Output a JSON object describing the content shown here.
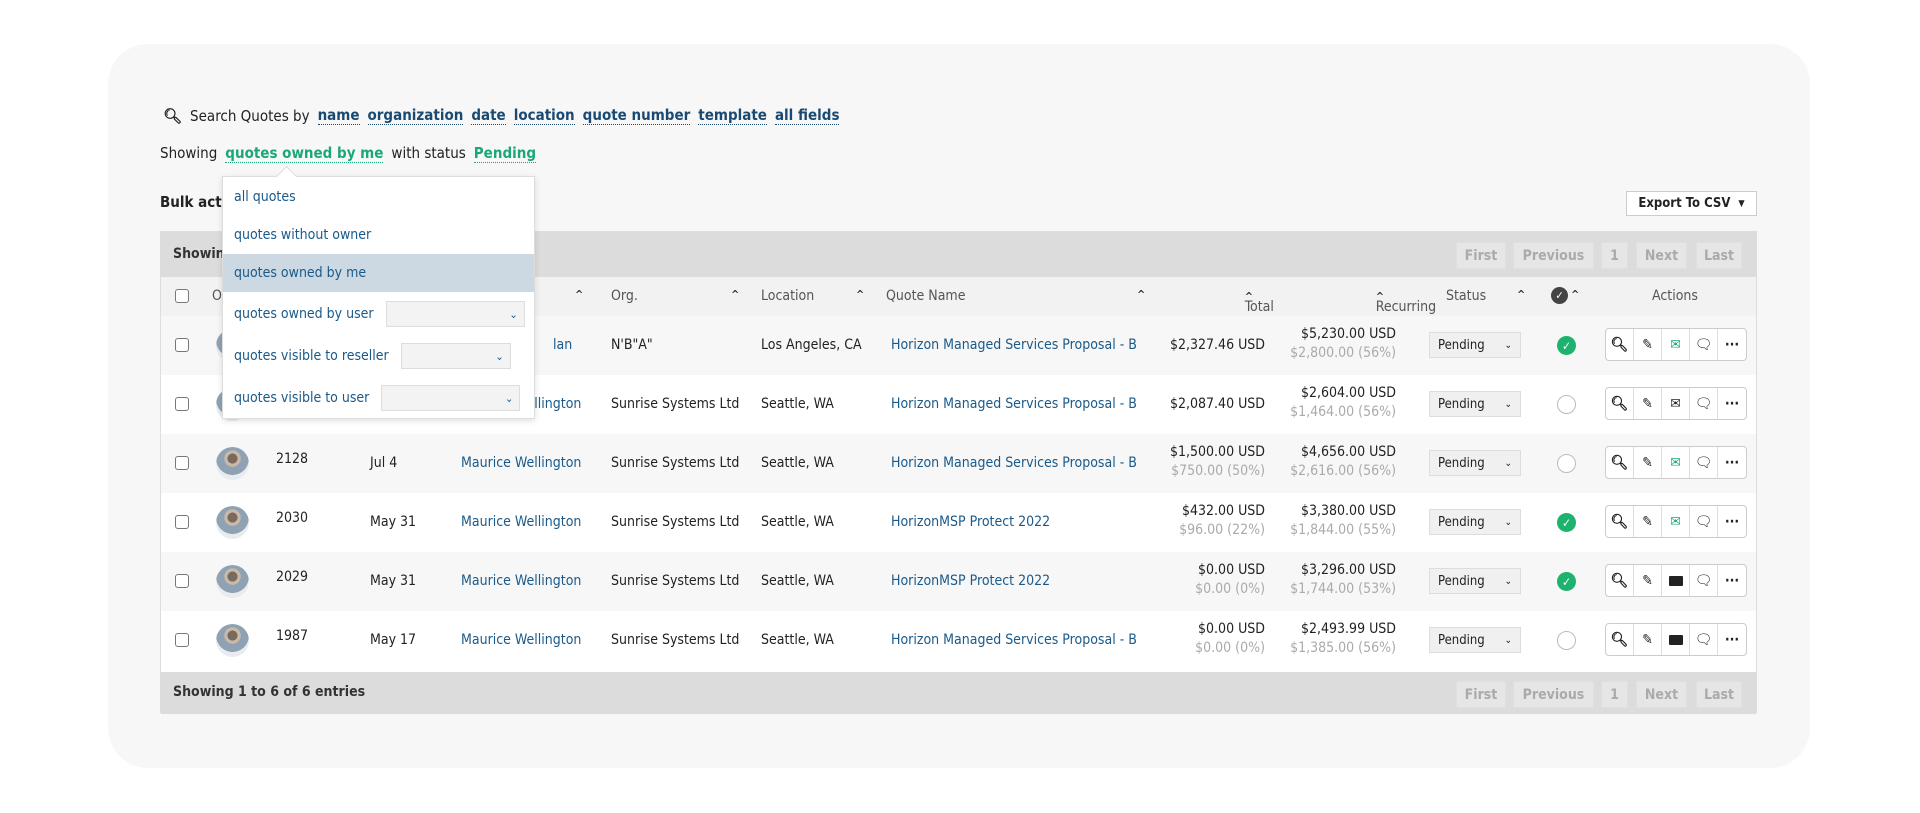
{
  "search": {
    "label": "Search Quotes by",
    "links": [
      "name",
      "organization",
      "date",
      "location",
      "quote number",
      "template",
      "all fields"
    ]
  },
  "filter": {
    "prefix": "Showing",
    "owner": "quotes owned by me",
    "mid": "with status",
    "status": "Pending"
  },
  "bulk_label": "Bulk actions",
  "export_label": "Export To CSV",
  "table": {
    "info": "Showing 1 to 6 of 6 entries",
    "pagination": [
      "First",
      "Previous",
      "1",
      "Next",
      "Last"
    ],
    "headers": {
      "owner": "O",
      "org": "Org.",
      "location": "Location",
      "quote_name": "Quote Name",
      "total": "Total",
      "recurring": "Recurring",
      "status": "Status",
      "actions": "Actions"
    },
    "rows": [
      {
        "num": "",
        "date": "",
        "name": "lan",
        "org": "N'B\"A\"",
        "location": "Los Angeles, CA",
        "quote": "Horizon Managed Services Proposal - B",
        "total": "$2,327.46 USD",
        "total_sub": "",
        "rec": "$5,230.00 USD",
        "rec_sub": "$2,800.00 (56%)",
        "status": "Pending",
        "approved": true,
        "mail": "open-green"
      },
      {
        "num": "",
        "date": "",
        "name": "Maurice Wellington",
        "org": "Sunrise Systems Ltd",
        "location": "Seattle, WA",
        "quote": "Horizon Managed Services Proposal - B",
        "total": "$2,087.40 USD",
        "total_sub": "",
        "rec": "$2,604.00 USD",
        "rec_sub": "$1,464.00 (56%)",
        "status": "Pending",
        "approved": false,
        "mail": "outline"
      },
      {
        "num": "2128",
        "date": "Jul 4",
        "name": "Maurice Wellington",
        "org": "Sunrise Systems Ltd",
        "location": "Seattle, WA",
        "quote": "Horizon Managed Services Proposal - B",
        "total": "$1,500.00 USD",
        "total_sub": "$750.00 (50%)",
        "rec": "$4,656.00 USD",
        "rec_sub": "$2,616.00 (56%)",
        "status": "Pending",
        "approved": false,
        "mail": "open-green"
      },
      {
        "num": "2030",
        "date": "May 31",
        "name": "Maurice Wellington",
        "org": "Sunrise Systems Ltd",
        "location": "Seattle, WA",
        "quote": "HorizonMSP Protect 2022",
        "total": "$432.00 USD",
        "total_sub": "$96.00 (22%)",
        "rec": "$3,380.00 USD",
        "rec_sub": "$1,844.00 (55%)",
        "status": "Pending",
        "approved": true,
        "mail": "open-green"
      },
      {
        "num": "2029",
        "date": "May 31",
        "name": "Maurice Wellington",
        "org": "Sunrise Systems Ltd",
        "location": "Seattle, WA",
        "quote": "HorizonMSP Protect 2022",
        "total": "$0.00 USD",
        "total_sub": "$0.00 (0%)",
        "rec": "$3,296.00 USD",
        "rec_sub": "$1,744.00 (53%)",
        "status": "Pending",
        "approved": true,
        "mail": "filled-black"
      },
      {
        "num": "1987",
        "date": "May 17",
        "name": "Maurice Wellington",
        "org": "Sunrise Systems Ltd",
        "location": "Seattle, WA",
        "quote": "Horizon Managed Services Proposal - B",
        "total": "$0.00 USD",
        "total_sub": "$0.00 (0%)",
        "rec": "$2,493.99 USD",
        "rec_sub": "$1,385.00 (56%)",
        "status": "Pending",
        "approved": false,
        "mail": "filled-black"
      }
    ]
  },
  "dropdown": {
    "items": [
      "all quotes",
      "quotes without owner",
      "quotes owned by me",
      "quotes owned by user",
      "quotes visible to reseller",
      "quotes visible to user"
    ],
    "selected": "quotes owned by me"
  },
  "colors": {
    "link": "#1a4a72",
    "accent": "#1aa77a",
    "approved": "#1db36e",
    "highlight": "#ccd9e2"
  }
}
